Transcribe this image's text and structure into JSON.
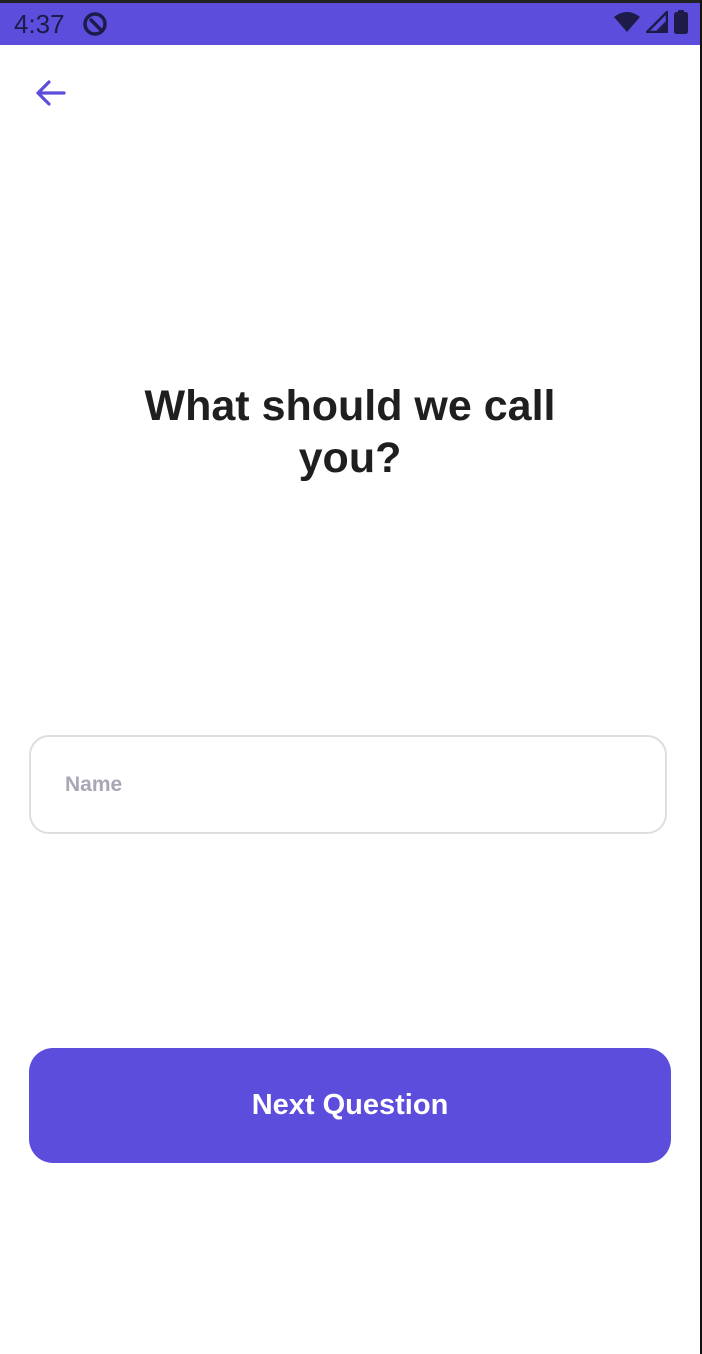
{
  "status_bar": {
    "time": "4:37",
    "background_color": "#5c4ddc",
    "icons": [
      "app-notification-icon",
      "wifi-icon",
      "cellular-signal-icon",
      "battery-icon"
    ]
  },
  "navigation": {
    "back_icon": "arrow-left-icon",
    "accent_color": "#5c4ddc"
  },
  "question": {
    "title": "What should we call you?"
  },
  "name_input": {
    "placeholder": "Name",
    "value": ""
  },
  "next_button": {
    "label": "Next Question",
    "background_color": "#5c4ddc"
  }
}
